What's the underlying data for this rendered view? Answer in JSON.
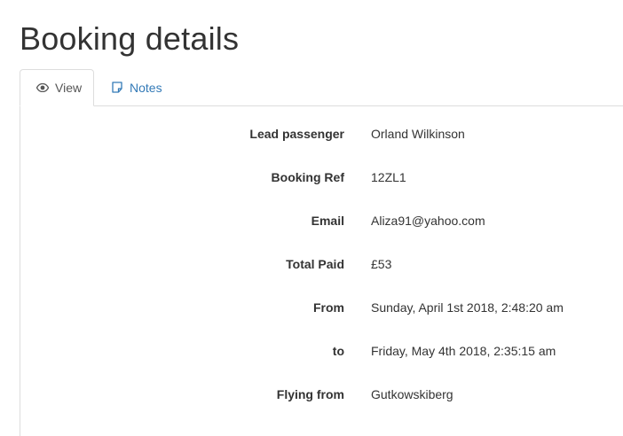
{
  "page": {
    "title": "Booking details"
  },
  "tabs": [
    {
      "label": "View",
      "icon": "eye-icon",
      "active": true
    },
    {
      "label": "Notes",
      "icon": "note-icon",
      "active": false
    }
  ],
  "colors": {
    "link": "#337ab7",
    "text": "#333333",
    "border": "#dddddd"
  },
  "details": [
    {
      "label": "Lead passenger",
      "value": "Orland Wilkinson"
    },
    {
      "label": "Booking Ref",
      "value": "12ZL1"
    },
    {
      "label": "Email",
      "value": "Aliza91@yahoo.com"
    },
    {
      "label": "Total Paid",
      "value": "£53"
    },
    {
      "label": "From",
      "value": "Sunday, April 1st 2018, 2:48:20 am"
    },
    {
      "label": "to",
      "value": "Friday, May 4th 2018, 2:35:15 am"
    },
    {
      "label": "Flying from",
      "value": "Gutkowskiberg"
    }
  ]
}
